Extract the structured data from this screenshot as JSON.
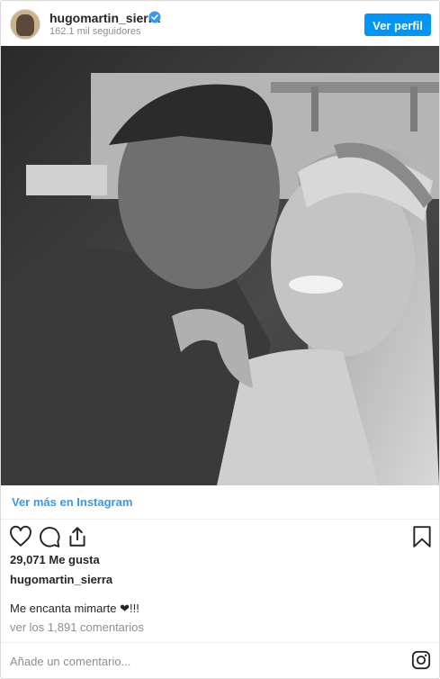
{
  "header": {
    "username": "hugomartin_sierra",
    "followers": "162.1 mil seguidores",
    "follow_label": "Ver perfil",
    "verified_icon": "verified-badge-icon"
  },
  "post": {
    "view_more_label": "Ver más en Instagram",
    "likes": "29,071 Me gusta",
    "caption_user": "hugomartin_sierra",
    "caption_text": "Me encanta mimarte ❤!!!",
    "comments_link": "ver los 1,891 comentarios",
    "comment_placeholder": "Añade un comentario..."
  },
  "icons": [
    "heart-icon",
    "comment-icon",
    "share-icon",
    "bookmark-icon",
    "instagram-logo-icon"
  ],
  "colors": {
    "accent": "#0095f6",
    "link": "#3897f0",
    "muted": "#8e8e8e"
  }
}
